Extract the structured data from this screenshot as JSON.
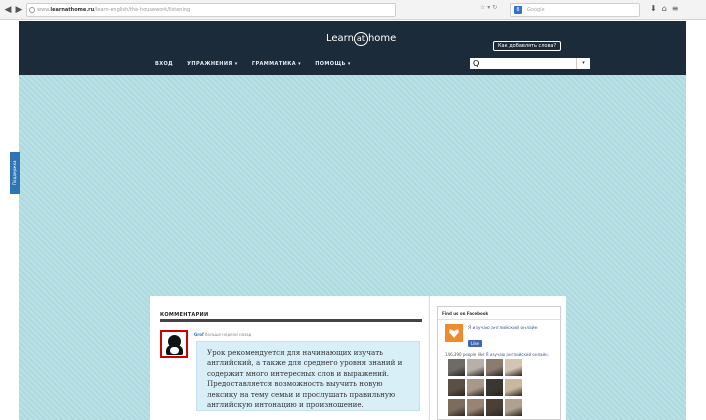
{
  "browser": {
    "url_domain": "learnathome.ru",
    "url_prefix": "www.",
    "url_path": "/learn-english/the-housework/listening",
    "search_placeholder": "Google",
    "icons": [
      "back-arrow-icon",
      "forward-arrow-icon",
      "globe-icon",
      "refresh-icon",
      "google-icon",
      "download-icon",
      "home-icon",
      "settings-icon"
    ]
  },
  "header": {
    "logo_left": "Learn",
    "logo_at": "at",
    "logo_right": "home",
    "tooltip": "Как добавлять слова?",
    "menu": [
      "ВХОД",
      "УПРАЖНЕНИЯ ▾",
      "ГРАММАТИКА ▾",
      "ПОМОЩЬ ▾"
    ],
    "search_value": "Q",
    "search_dropdown": "▾"
  },
  "feedback_tab": "Поддержка",
  "comments": {
    "title": "КОММЕНТАРИИ",
    "author": "Grof",
    "meta": "больше недели назад",
    "text": "Урок рекомендуется для начинающих изучать английский, а также для среднего уровня знаний и содержит много интересных слов и выражений. Предоставляется возможность выучить новую лексику на тему семьи и прослушать правильную английскую интонацию и произношение."
  },
  "facebook": {
    "header": "Find us on Facebook",
    "page_name": "Я изучаю английский онлайн",
    "like_label": "Like",
    "count_text": "146,390 people like",
    "count_link": "Я изучаю английский онлайн.",
    "colors": {
      "brand": "#3b5998",
      "accent": "#f08a2c"
    },
    "faces": [
      "#6e6a66",
      "#b8b0a8",
      "#8c7c70",
      "#d4c4b4",
      "#5a5046",
      "#a89888",
      "#3c3630",
      "#c8b8a0",
      "#7c6c5c",
      "#988474",
      "#4a4036",
      "#b0a090"
    ]
  },
  "colors": {
    "header_bg": "#1c2b3a",
    "page_bg": "#b9e2e6",
    "comment_bg": "#d9eff8",
    "feedback_tab": "#2f74b5"
  }
}
